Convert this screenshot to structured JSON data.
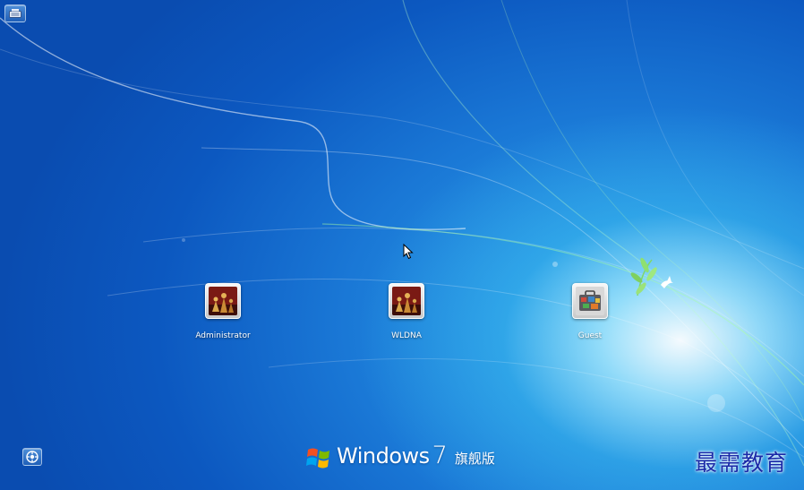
{
  "users": [
    {
      "name": "Administrator",
      "picture": "chess-pieces-picture"
    },
    {
      "name": "WLDNA",
      "picture": "chess-pieces-picture"
    },
    {
      "name": "Guest",
      "picture": "suitcase-picture"
    }
  ],
  "branding": {
    "name": "Windows",
    "version": "7",
    "edition": "旗舰版"
  },
  "watermark": {
    "text": "最需教育"
  },
  "icons": {
    "top_left": "keyboard-icon",
    "bottom_left": "ease-of-access-icon",
    "logo": "windows-flag-icon"
  },
  "colors": {
    "background": "#1a78d6",
    "glow": "#bfefff",
    "watermark": "#1a2aa8"
  }
}
